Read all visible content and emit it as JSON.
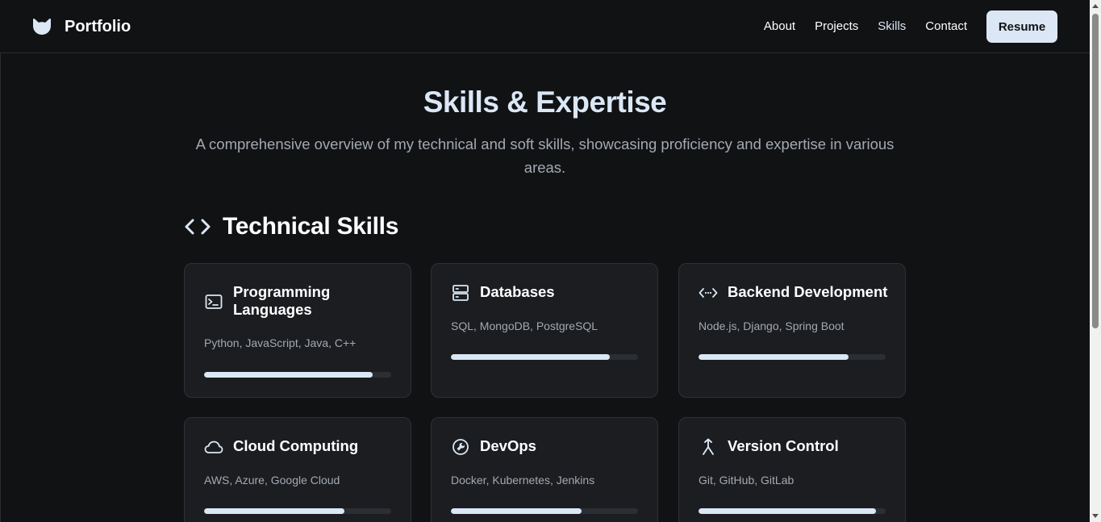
{
  "header": {
    "brand": "Portfolio",
    "nav": [
      "About",
      "Projects",
      "Skills",
      "Contact"
    ],
    "active_nav": "Skills",
    "resume_label": "Resume"
  },
  "hero": {
    "title": "Skills & Expertise",
    "subtitle": "A comprehensive overview of my technical and soft skills, showcasing proficiency and expertise in various areas."
  },
  "technical": {
    "title": "Technical Skills",
    "icon": "code-brackets-icon",
    "cards": [
      {
        "title": "Programming Languages",
        "icon": "terminal-icon",
        "items": "Python, JavaScript, Java, C++",
        "level": 0.9
      },
      {
        "title": "Databases",
        "icon": "database-server-icon",
        "items": "SQL, MongoDB, PostgreSQL",
        "level": 0.85
      },
      {
        "title": "Backend Development",
        "icon": "code-arrows-icon",
        "items": "Node.js, Django, Spring Boot",
        "level": 0.8
      },
      {
        "title": "Cloud Computing",
        "icon": "cloud-icon",
        "items": "AWS, Azure, Google Cloud",
        "level": 0.75
      },
      {
        "title": "DevOps",
        "icon": "wrench-badge-icon",
        "items": "Docker, Kubernetes, Jenkins",
        "level": 0.7
      },
      {
        "title": "Version Control",
        "icon": "git-merge-icon",
        "items": "Git, GitHub, GitLab",
        "level": 0.95
      }
    ]
  },
  "colors": {
    "background": "#111214",
    "card": "#1b1d20",
    "accent": "#dbe7f5",
    "muted_text": "#a3a9b2",
    "track": "#2b2e33"
  }
}
